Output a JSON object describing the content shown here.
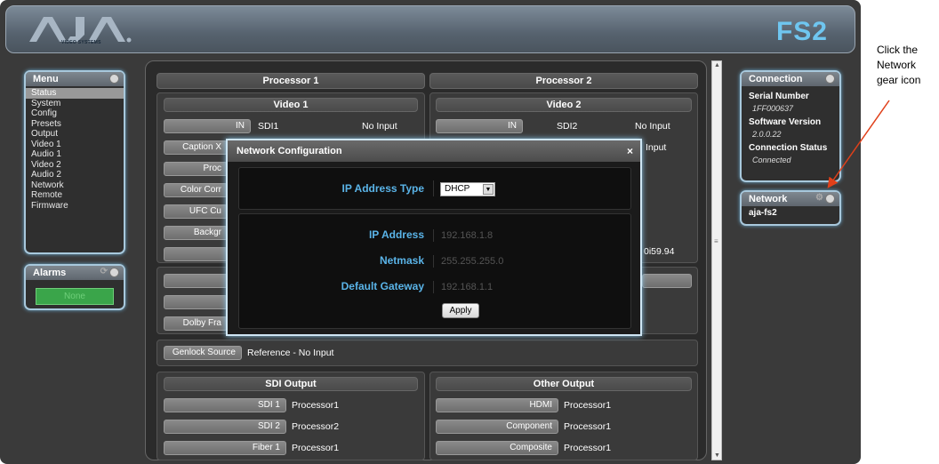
{
  "header": {
    "logo_text": "AJA",
    "logo_sub": "VIDEO SYSTEMS",
    "model": "FS2"
  },
  "menu": {
    "title": "Menu",
    "items": [
      "Status",
      "System",
      "Config",
      "Presets",
      "Output",
      "Video 1",
      "Audio 1",
      "Video 2",
      "Audio 2",
      "Network",
      "Remote",
      "Firmware"
    ],
    "active": "Status"
  },
  "alarms": {
    "title": "Alarms",
    "button": "None"
  },
  "processors": {
    "p1": {
      "title": "Processor 1",
      "video_title": "Video 1",
      "in_btn": "IN",
      "source": "SDI1",
      "status": "No Input",
      "buttons": [
        "Caption X",
        "Proc",
        "Color Corr",
        "UFC Cu",
        "Backgr"
      ]
    },
    "p2": {
      "title": "Processor 2",
      "video_title": "Video 2",
      "in_btn": "IN",
      "source": "SDI2",
      "status": "No Input",
      "status2": "Input",
      "fmt": "0i59.94"
    },
    "p1_lower_btn": "Dolby Fra"
  },
  "genlock": {
    "label": "Genlock Source",
    "value": "Reference - No Input"
  },
  "sdi_output": {
    "title": "SDI Output",
    "rows": [
      {
        "label": "SDI 1",
        "value": "Processor1"
      },
      {
        "label": "SDI 2",
        "value": "Processor2"
      },
      {
        "label": "Fiber 1",
        "value": "Processor1"
      }
    ]
  },
  "other_output": {
    "title": "Other Output",
    "rows": [
      {
        "label": "HDMI",
        "value": "Processor1"
      },
      {
        "label": "Component",
        "value": "Processor1"
      },
      {
        "label": "Composite",
        "value": "Processor1"
      }
    ]
  },
  "modal": {
    "title": "Network Configuration",
    "close": "×",
    "ip_type_label": "IP Address Type",
    "ip_type_value": "DHCP",
    "ip_label": "IP Address",
    "ip_value": "192.168.1.8",
    "netmask_label": "Netmask",
    "netmask_value": "255.255.255.0",
    "gateway_label": "Default Gateway",
    "gateway_value": "192.168.1.1",
    "apply": "Apply"
  },
  "connection": {
    "title": "Connection",
    "serial_label": "Serial Number",
    "serial_value": "1FF000637",
    "software_label": "Software Version",
    "software_value": "2.0.0.22",
    "status_label": "Connection Status",
    "status_value": "Connected"
  },
  "network_panel": {
    "title": "Network",
    "item": "aja-fs2"
  },
  "annotation": {
    "line1": "Click the",
    "line2": "Network",
    "line3": "gear icon"
  },
  "colors": {
    "accent_blue": "#5ab4e8",
    "annotation_arrow": "#e0401a",
    "alarm_green": "#3aa54a"
  }
}
